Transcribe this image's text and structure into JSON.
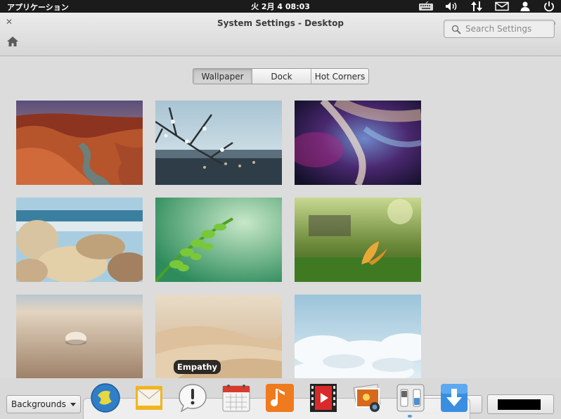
{
  "panel": {
    "applications_label": "アプリケーション",
    "clock": "火  2月  4 08:03",
    "indicators": [
      "keyboard-icon",
      "volume-icon",
      "network-icon",
      "mail-icon",
      "user-icon",
      "power-icon"
    ]
  },
  "window": {
    "title": "System Settings - Desktop",
    "close_icon": "close-icon",
    "maximize_icon": "maximize-icon",
    "home_icon": "home-icon"
  },
  "search": {
    "placeholder": "Search Settings",
    "value": ""
  },
  "tabs": [
    {
      "label": "Wallpaper",
      "active": true
    },
    {
      "label": "Dock",
      "active": false
    },
    {
      "label": "Hot Corners",
      "active": false
    }
  ],
  "wallpapers": [
    {
      "name": "canyon"
    },
    {
      "name": "frosted-branch-city"
    },
    {
      "name": "purple-nebula"
    },
    {
      "name": "rocky-shore"
    },
    {
      "name": "green-leaves"
    },
    {
      "name": "leaf-on-grass"
    },
    {
      "name": "seashell-beach"
    },
    {
      "name": "sand-dunes"
    },
    {
      "name": "clouds"
    }
  ],
  "tooltip": "Empathy",
  "background_select": {
    "value": "Backgrounds"
  },
  "color": {
    "value": "#000000"
  },
  "dock": [
    {
      "name": "browser-icon"
    },
    {
      "name": "mail-client-icon"
    },
    {
      "name": "empathy-icon"
    },
    {
      "name": "calendar-icon"
    },
    {
      "name": "music-icon"
    },
    {
      "name": "video-icon"
    },
    {
      "name": "photos-icon"
    },
    {
      "name": "system-settings-icon",
      "active": true
    },
    {
      "name": "software-center-icon"
    }
  ]
}
